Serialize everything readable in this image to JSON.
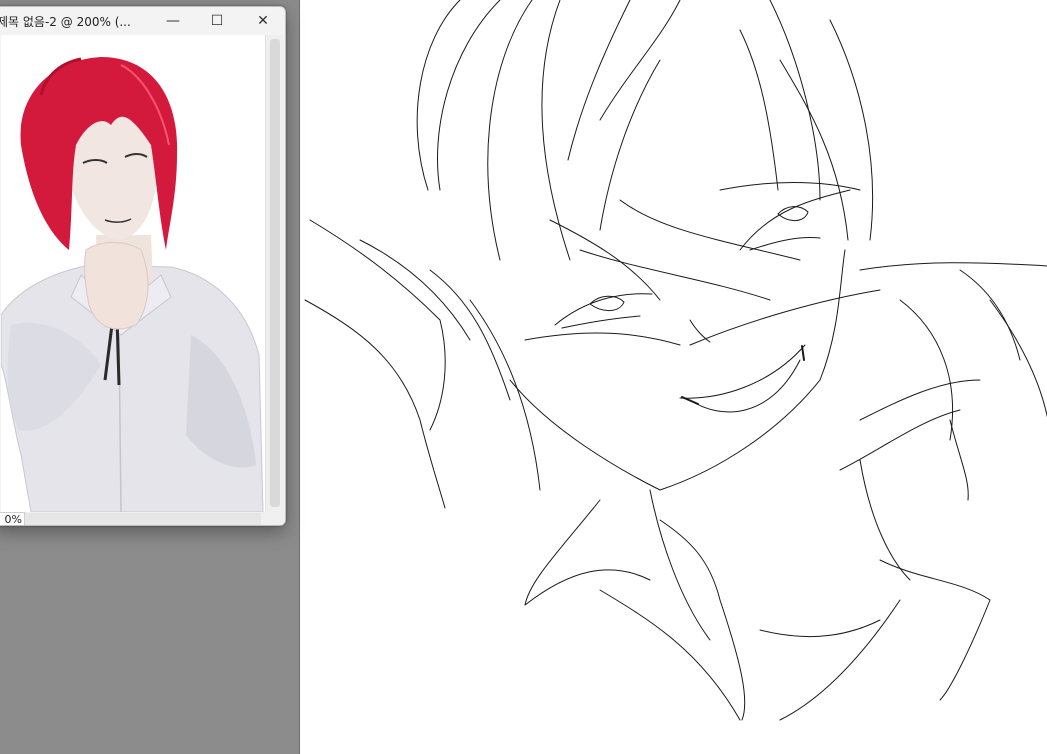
{
  "window": {
    "title": "제목 없음-2 @ 200% (...",
    "zoom_label": "0%",
    "minimize_glyph": "—",
    "maximize_glyph": "☐",
    "close_glyph": "✕"
  },
  "icons": {
    "minimize": "minimize-icon",
    "maximize": "maximize-icon",
    "close": "close-icon"
  },
  "colors": {
    "workspace": "#8c8c8c",
    "canvas": "#ffffff",
    "hair": "#d41a3c",
    "shirt": "#e6e6ec",
    "skin": "#f1e6e2"
  }
}
